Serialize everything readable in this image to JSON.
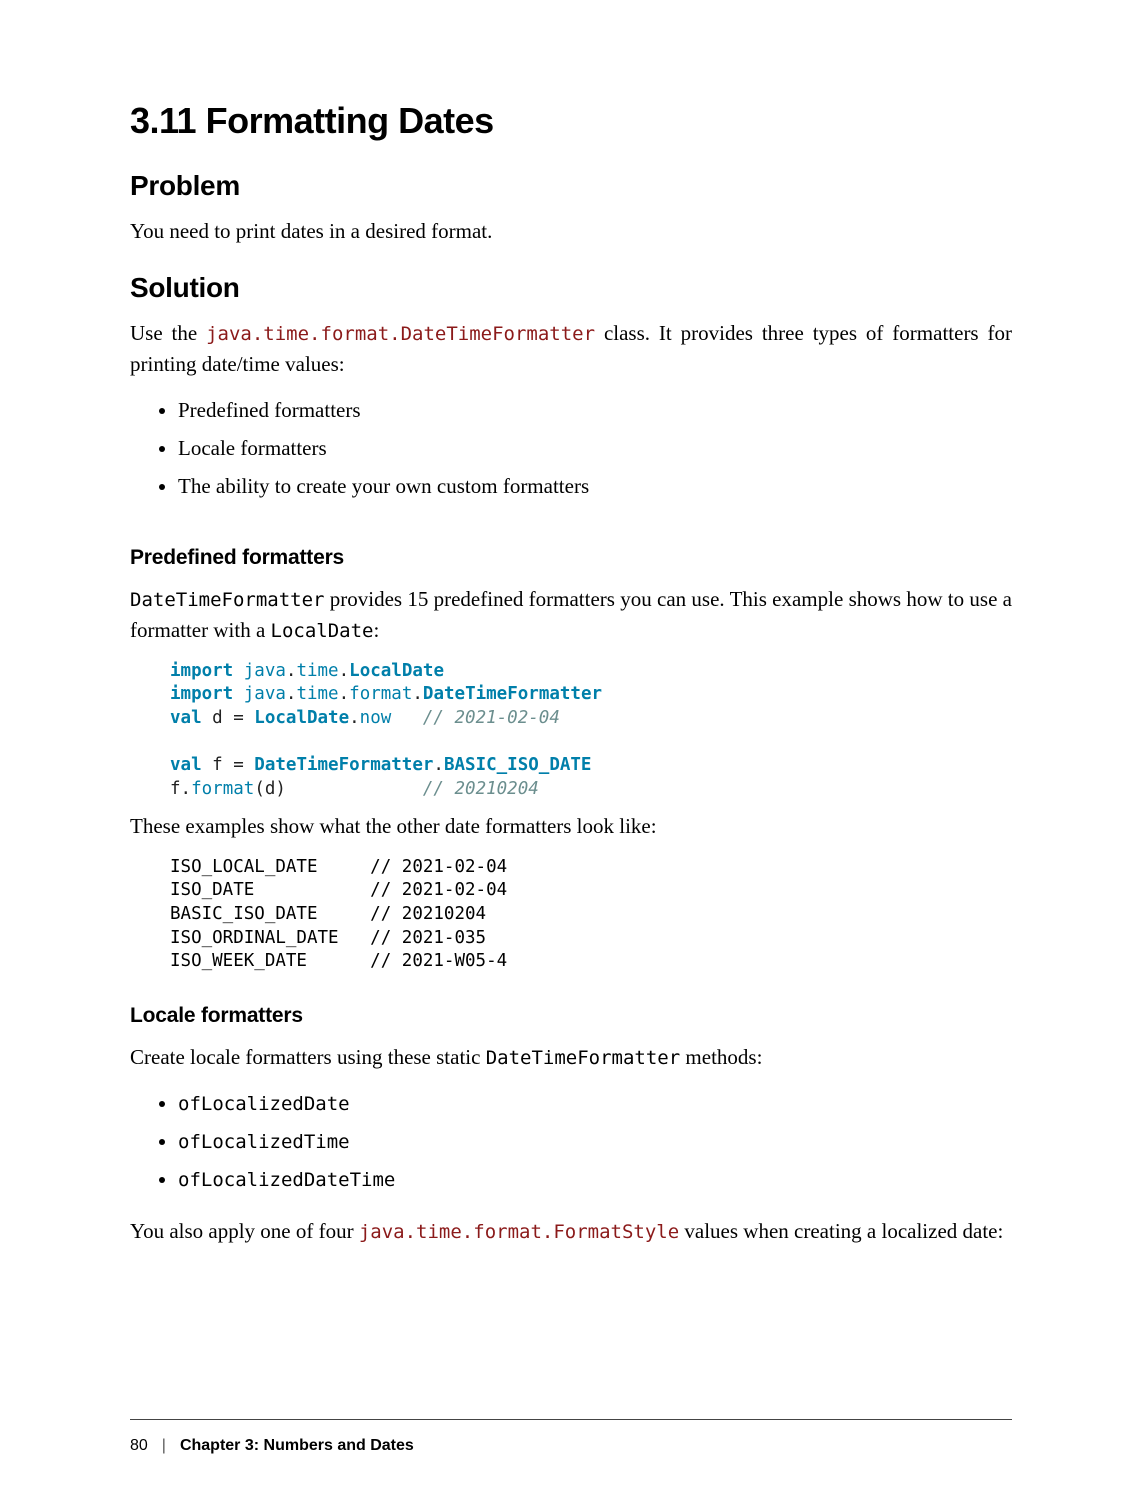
{
  "title": "3.11 Formatting Dates",
  "problem": {
    "heading": "Problem",
    "text": "You need to print dates in a desired format."
  },
  "solution": {
    "heading": "Solution",
    "intro_pre": "Use the ",
    "intro_code": "java.time.format.DateTimeFormatter",
    "intro_post": " class. It provides three types of for­matters for printing date/time values:",
    "bullets": [
      "Predefined formatters",
      "Locale formatters",
      "The ability to create your own custom formatters"
    ]
  },
  "predefined": {
    "heading": "Predefined formatters",
    "para_code": "DateTimeFormatter",
    "para_mid": " provides 15 predefined formatters you can use. This example shows how to use a formatter with a ",
    "para_code2": "LocalDate",
    "para_end": ":",
    "code": {
      "l1_kw": "import",
      "l1_pkg": " java",
      "l1_d1": ".",
      "l1_pkg2": "time",
      "l1_d2": ".",
      "l1_cls": "LocalDate",
      "l2_kw": "import",
      "l2_pkg": " java",
      "l2_d1": ".",
      "l2_pkg2": "time",
      "l2_d2": ".",
      "l2_pkg3": "format",
      "l2_d3": ".",
      "l2_cls": "DateTimeFormatter",
      "l3_kw": "val",
      "l3_v": " d ",
      "l3_eq": "= ",
      "l3_cls": "LocalDate",
      "l3_d": ".",
      "l3_m": "now",
      "l3_sp": "   ",
      "l3_c": "// 2021-02-04",
      "l4": "",
      "l5_kw": "val",
      "l5_v": " f ",
      "l5_eq": "= ",
      "l5_cls": "DateTimeFormatter",
      "l5_d": ".",
      "l5_const": "BASIC_ISO_DATE",
      "l6_a": "f",
      "l6_d": ".",
      "l6_m": "format",
      "l6_p": "(d)",
      "l6_sp": "             ",
      "l6_c": "// 20210204"
    },
    "after_code": "These examples show what the other date formatters look like:",
    "examples": "ISO_LOCAL_DATE     // 2021-02-04\nISO_DATE           // 2021-02-04\nBASIC_ISO_DATE     // 20210204\nISO_ORDINAL_DATE   // 2021-035\nISO_WEEK_DATE      // 2021-W05-4"
  },
  "locale": {
    "heading": "Locale formatters",
    "intro_pre": "Create locale formatters using these static ",
    "intro_code": "DateTimeFormatter",
    "intro_post": " methods:",
    "bullets": [
      "ofLocalizedDate",
      "ofLocalizedTime",
      "ofLocalizedDateTime"
    ],
    "outro_pre": "You also apply one of four ",
    "outro_code": "java.time.format.FormatStyle",
    "outro_post": " values when creating a localized date:"
  },
  "footer": {
    "page": "80",
    "sep": "|",
    "chapter": "Chapter 3: Numbers and Dates"
  }
}
